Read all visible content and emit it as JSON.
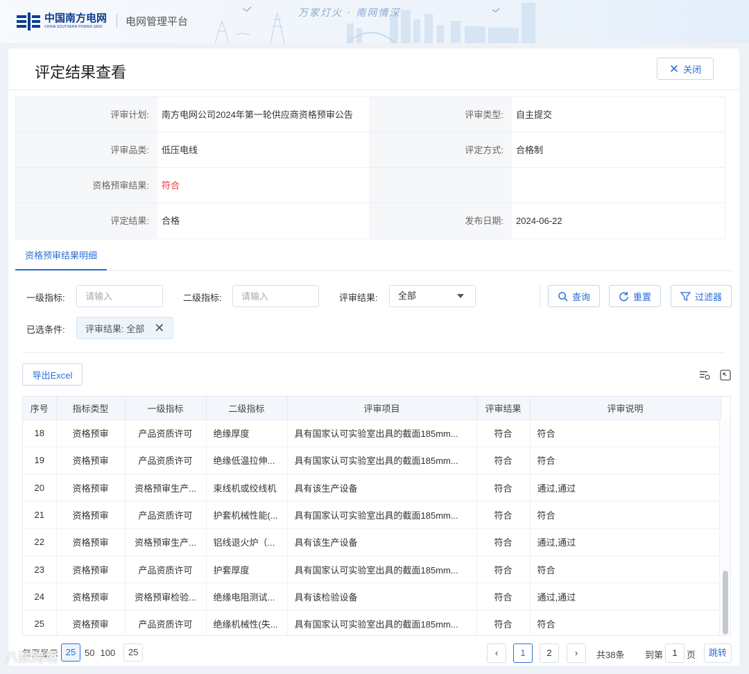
{
  "header": {
    "logo_cn": "中国南方电网",
    "logo_en": "CHINA SOUTHERN POWER GRID",
    "platform": "电网管理平台",
    "slogan": "万家灯火 · 南网情深"
  },
  "page": {
    "title": "评定结果查看",
    "close_label": "关闭"
  },
  "info": {
    "rows": [
      {
        "l1": "评审计划:",
        "v1": "南方电网公司2024年第一轮供应商资格预审公告",
        "l2": "评审类型:",
        "v2": "自主提交"
      },
      {
        "l1": "评审品类:",
        "v1": "低压电线",
        "l2": "评定方式:",
        "v2": "合格制"
      },
      {
        "l1": "资格预审结果:",
        "v1": "符合",
        "l2": "",
        "v2": ""
      },
      {
        "l1": "评定结果:",
        "v1": "合格",
        "l2": "发布日期:",
        "v2": "2024-06-22"
      }
    ],
    "colors": {
      "result_red": "#e33333"
    }
  },
  "tabs": [
    {
      "label": "资格预审结果明细",
      "active": true
    }
  ],
  "filters": {
    "level1_label": "一级指标:",
    "level1_placeholder": "请输入",
    "level2_label": "二级指标:",
    "level2_placeholder": "请输入",
    "result_label": "评审结果:",
    "result_value": "全部",
    "query_label": "查询",
    "reset_label": "重置",
    "filter_label": "过滤器",
    "selected_label": "已选条件:",
    "chip_label": "评审结果: 全部"
  },
  "toolbar": {
    "export_label": "导出Excel"
  },
  "table": {
    "columns": [
      "序号",
      "指标类型",
      "一级指标",
      "二级指标",
      "评审项目",
      "评审结果",
      "评审说明"
    ],
    "rows": [
      [
        "18",
        "资格预审",
        "产品资质许可",
        "绝缘厚度",
        "具有国家认可实验室出具的截面185mm...",
        "符合",
        "符合"
      ],
      [
        "19",
        "资格预审",
        "产品资质许可",
        "绝缘低温拉伸...",
        "具有国家认可实验室出具的截面185mm...",
        "符合",
        "符合"
      ],
      [
        "20",
        "资格预审",
        "资格预审生产...",
        "束线机或绞线机",
        "具有该生产设备",
        "符合",
        "通过,通过"
      ],
      [
        "21",
        "资格预审",
        "产品资质许可",
        "护套机械性能(...",
        "具有国家认可实验室出具的截面185mm...",
        "符合",
        "符合"
      ],
      [
        "22",
        "资格预审",
        "资格预审生产...",
        "铝线退火炉（...",
        "具有该生产设备",
        "符合",
        "通过,通过"
      ],
      [
        "23",
        "资格预审",
        "产品资质许可",
        "护套厚度",
        "具有国家认可实验室出具的截面185mm...",
        "符合",
        "符合"
      ],
      [
        "24",
        "资格预审",
        "资格预审检验...",
        "绝缘电阻测试...",
        "具有该检验设备",
        "符合",
        "通过,通过"
      ],
      [
        "25",
        "资格预审",
        "产品资质许可",
        "绝缘机械性(失...",
        "具有国家认可实验室出具的截面185mm...",
        "符合",
        "符合"
      ]
    ]
  },
  "pagination": {
    "per_page_label": "每页显示",
    "sizes": [
      "25",
      "50",
      "100"
    ],
    "active_size": "25",
    "size_select": "25",
    "prev": "‹",
    "pages": [
      "1",
      "2"
    ],
    "current_page": "1",
    "next": "›",
    "total": "共38条",
    "goto_label": "到第",
    "goto_value": "1",
    "page_unit": "页",
    "jump_label": "跳转"
  },
  "watermark": "八数跨境",
  "colors": {
    "accent": "#2b6ed4",
    "brand": "#0a3d8f"
  }
}
